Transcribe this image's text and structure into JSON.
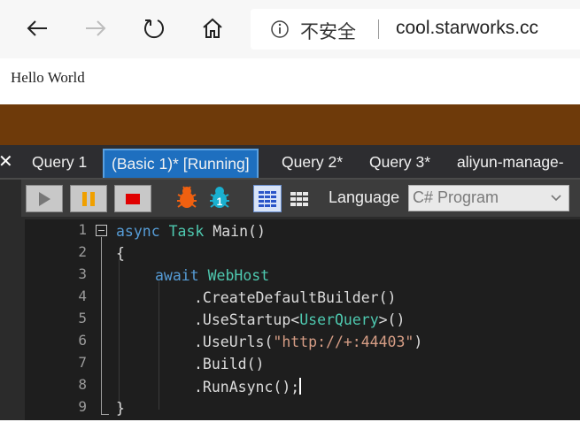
{
  "browser": {
    "address": {
      "security_label": "不安全",
      "url": "cool.starworks.cc"
    }
  },
  "page": {
    "text": "Hello World"
  },
  "app": {
    "tabs": [
      {
        "label": "Query 1"
      },
      {
        "label": "(Basic 1)* [Running]"
      },
      {
        "label": "Query 2*"
      },
      {
        "label": "Query 3*"
      },
      {
        "label": "aliyun-manage-"
      }
    ],
    "toolbar": {
      "language_label": "Language",
      "language_value": "C# Program"
    },
    "editor": {
      "line_numbers": [
        "1",
        "2",
        "3",
        "4",
        "5",
        "6",
        "7",
        "8",
        "9"
      ],
      "lines": [
        {
          "k1": "async",
          "t1": "Task",
          "rest": " Main()"
        },
        {
          "text": "{"
        },
        {
          "k1": "await",
          "t1": "WebHost"
        },
        {
          "text": ".CreateDefaultBuilder()"
        },
        {
          "pre": ".UseStartup<",
          "t1": "UserQuery",
          "post": ">()"
        },
        {
          "pre": ".UseUrls(",
          "str": "\"http://+:44403\"",
          "post": ")"
        },
        {
          "text": ".Build()"
        },
        {
          "text": ".RunAsync();"
        },
        {
          "text": "}"
        }
      ]
    }
  },
  "colors": {
    "brown_band": "#6e3a0a",
    "active_tab": "#1e6fbf",
    "keyword": "#569cd6",
    "type": "#4ec9b0",
    "string": "#d69d85"
  }
}
